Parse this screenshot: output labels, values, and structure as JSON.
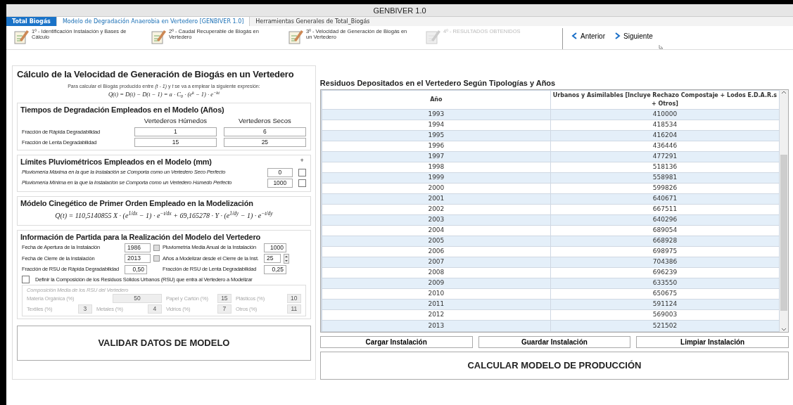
{
  "window": {
    "title": "GENBIVER 1.0"
  },
  "tabs": [
    {
      "label": "Total Biogás",
      "kind": "app",
      "selected": false
    },
    {
      "label": "Modelo de Degradación Anaerobia en Vertedero [GENBIVER 1.0]",
      "kind": "tab",
      "selected": true
    },
    {
      "label": "Herramientas Generales de Total_Biogás",
      "kind": "tab",
      "selected": false
    }
  ],
  "ribbon": {
    "steps": [
      {
        "label": "1º - Identificación Instalación y Bases de Cálculo",
        "disabled": false
      },
      {
        "label": "2º - Caudal Recuperable de Biogás en Vertedero",
        "disabled": false
      },
      {
        "label": "3º - Velocidad de Generación de Biogás en un Vertedero",
        "disabled": false
      },
      {
        "label": "4º - RESULTADOS OBTENIDOS",
        "disabled": true
      }
    ],
    "nav": [
      {
        "label": "Anterior",
        "kind": "prev"
      },
      {
        "label": "Siguiente",
        "kind": "next"
      }
    ]
  },
  "main": {
    "title": "Cálculo de la Velocidad de Generación de Biogás en un Vertedero",
    "intro": "Para calcular el Biogás producido entre *(t - 1)* y *t* se va a emplear la siguiente expresión:",
    "formula": "Q(t) = D(t) − D(t − 1) = a · C$_{0}$ · (e$^{k}$ − 1) · e$^{−kt}$"
  },
  "degradation": {
    "title": "Tiempos de Degradación Empleados en el Modelo (Años)",
    "columns": [
      "Vertederos Húmedos",
      "Vertederos Secos"
    ],
    "rows": [
      {
        "label": "Fracción de Rápida Degradabilidad",
        "values": [
          "1",
          "6"
        ]
      },
      {
        "label": "Fracción de Lenta Degradabilidad",
        "values": [
          "15",
          "25"
        ]
      }
    ]
  },
  "rain_limits": {
    "title": "Límites Pluviométricos Empleados en el Modelo (mm)",
    "plus": "+",
    "rows": [
      {
        "label": "Pluviomería Máxima en la que la Instalación se Comporta como un Vertedero Seco Perfecto",
        "value": "0",
        "checked": false
      },
      {
        "label": "Pluviomería Mínima en la que la Instalación se Comporta como un Vertedero Húmedo Perfecto",
        "value": "1000",
        "checked": false
      }
    ]
  },
  "model": {
    "title": "Módelo Cinegético de Primer Orden Empleado en la Modelización",
    "formula": "Q(t) = 110,5140855 X · (e$^{1/dx}$ − 1) · e$^{−t/dx}$ + 69,165278 · Y · (e$^{1/dy}$ − 1) · e$^{−t/dy}$"
  },
  "info": {
    "title": "Información de Partida para la Realización del Modelo del Vertedero",
    "fields": [
      {
        "label": "Fecha de Apertura de la Instalación",
        "value": "1986",
        "kind": "date"
      },
      {
        "label": "Pluviometría Media Anual de la Instalación",
        "value": "1000",
        "kind": "text"
      },
      {
        "label": "Fecha de Cierre de la Instalación",
        "value": "2013",
        "kind": "date"
      },
      {
        "label": "Años a Modelizar desde el Cierre de la Inst.",
        "value": "25",
        "kind": "spin"
      },
      {
        "label": "Fracción de RSU de Rápida Degradabilidad",
        "value": "0,50",
        "kind": "text"
      },
      {
        "label": "Fracción de RSU de Lenta Degradabilidad",
        "value": "0,25",
        "kind": "text"
      }
    ],
    "define": {
      "label": "Definir la Composición de los Residuos Sólidos Urbanos (RSU) que entra al Vertedero a Modelizar",
      "checked": false
    },
    "composition": {
      "title": "Composición Media de los RSU del Vertedero",
      "disabled": true,
      "fields": [
        {
          "label": "Materia Orgánica (%)",
          "value": "50"
        },
        {
          "label": "Papel y Cartón (%)",
          "value": "15"
        },
        {
          "label": "Plásticos (%)",
          "value": "10"
        },
        {
          "label": "Textiles (%)",
          "value": "3"
        },
        {
          "label": "Metales (%)",
          "value": "4"
        },
        {
          "label": "Vidrios (%)",
          "value": "7"
        },
        {
          "label": "Otros (%)",
          "value": "11"
        }
      ]
    }
  },
  "validate_button": "VALIDAR DATOS DE MODELO",
  "table": {
    "title": "Residuos Depositados en el Vertedero Según Tipologías y Años",
    "columns": [
      "Año",
      "Urbanos y Asimilables [Incluye Rechazo Compostaje + Lodos E.D.A.R.s + Otros]"
    ],
    "rows": [
      [
        "1993",
        "410000"
      ],
      [
        "1994",
        "418534"
      ],
      [
        "1995",
        "416204"
      ],
      [
        "1996",
        "436446"
      ],
      [
        "1997",
        "477291"
      ],
      [
        "1998",
        "518136"
      ],
      [
        "1999",
        "558981"
      ],
      [
        "2000",
        "599826"
      ],
      [
        "2001",
        "640671"
      ],
      [
        "2002",
        "667511"
      ],
      [
        "2003",
        "640296"
      ],
      [
        "2004",
        "689054"
      ],
      [
        "2005",
        "668928"
      ],
      [
        "2006",
        "698975"
      ],
      [
        "2007",
        "704386"
      ],
      [
        "2008",
        "696239"
      ],
      [
        "2009",
        "633550"
      ],
      [
        "2010",
        "650675"
      ],
      [
        "2011",
        "591124"
      ],
      [
        "2012",
        "569003"
      ],
      [
        "2013",
        "521502"
      ]
    ]
  },
  "actions": [
    "Cargar Instalación",
    "Guardar Instalación",
    "Limpiar Instalación"
  ],
  "calculate_button": "CALCULAR MODELO DE PRODUCCIÓN"
}
